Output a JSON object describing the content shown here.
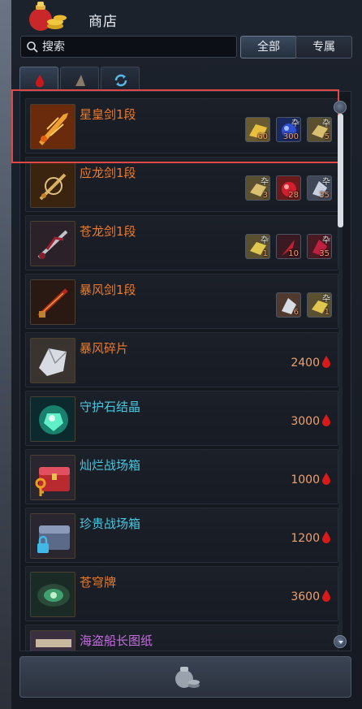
{
  "window": {
    "title": "商店"
  },
  "search": {
    "placeholder": "搜索"
  },
  "filters": [
    {
      "label": "全部",
      "active": true
    },
    {
      "label": "专属",
      "active": false
    }
  ],
  "tabs": [
    {
      "icon": "red-drop-icon",
      "active": true
    },
    {
      "icon": "flag-icon",
      "active": false
    },
    {
      "icon": "refresh-icon",
      "active": false
    }
  ],
  "items": [
    {
      "name": "星皇剑1段",
      "color": "orange",
      "materials": [
        "60",
        "300",
        "5"
      ]
    },
    {
      "name": "应龙剑1段",
      "color": "orange",
      "materials": [
        "3",
        "28",
        "35"
      ]
    },
    {
      "name": "苍龙剑1段",
      "color": "orange",
      "materials": [
        "1",
        "10",
        "35"
      ]
    },
    {
      "name": "暴风剑1段",
      "color": "orange",
      "materials": [
        "6",
        "1"
      ]
    },
    {
      "name": "暴风碎片",
      "color": "orange",
      "price": "2400"
    },
    {
      "name": "守护石结晶",
      "color": "cyan",
      "price": "3000"
    },
    {
      "name": "灿烂战场箱",
      "color": "cyan",
      "price": "1000"
    },
    {
      "name": "珍贵战场箱",
      "color": "cyan",
      "price": "1200"
    },
    {
      "name": "苍穹牌",
      "color": "orange",
      "price": "3600"
    },
    {
      "name": "海盗船长图纸",
      "color": "purple"
    }
  ],
  "material_mark": "卆",
  "colors": {
    "accent": "#ee7b2a",
    "currency": "#d81a1a",
    "highlight": "#e04848"
  }
}
